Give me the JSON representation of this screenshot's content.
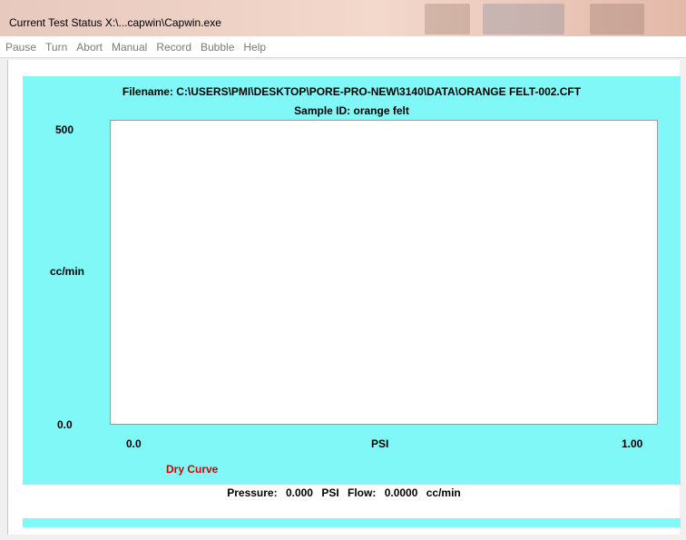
{
  "window": {
    "title": "Current Test Status   X:\\...capwin\\Capwin.exe"
  },
  "menu": {
    "items": [
      "Pause",
      "Turn",
      "Abort",
      "Manual",
      "Record",
      "Bubble",
      "Help"
    ]
  },
  "colors": {
    "panel": "#80f8f8",
    "legend": "#d40000",
    "plot_bg": "#ffffff"
  },
  "header": {
    "filename": "Filename:  C:\\USERS\\PMI\\DESKTOP\\PORE-PRO-NEW\\3140\\DATA\\ORANGE FELT-002.CFT",
    "sample_id": "Sample ID: orange felt"
  },
  "chart_data": {
    "type": "line",
    "title": "",
    "xlabel": "PSI",
    "ylabel": "cc/min",
    "x_ticks": [
      "0.0",
      "1.00"
    ],
    "y_ticks": [
      "0.0",
      "500"
    ],
    "xlim": [
      0.0,
      1.0
    ],
    "ylim": [
      0.0,
      500
    ],
    "series": [
      {
        "name": "Dry Curve",
        "color": "#d40000",
        "x": [],
        "y": []
      }
    ]
  },
  "status": {
    "pressure_label": "Pressure:",
    "pressure_value": "0.000",
    "pressure_unit": "PSI",
    "flow_label": "Flow:",
    "flow_value": "0.0000",
    "flow_unit": "cc/min"
  }
}
